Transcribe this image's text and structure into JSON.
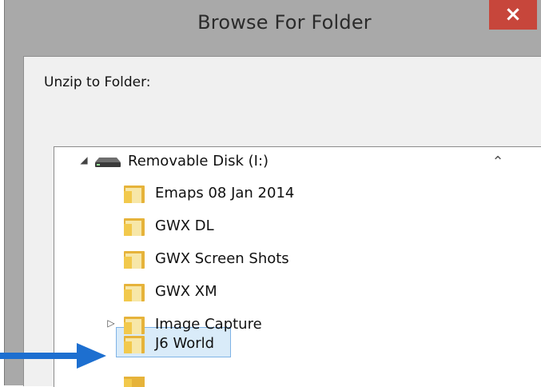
{
  "window": {
    "title": "Browse For Folder",
    "close_label": "×"
  },
  "dialog": {
    "prompt": "Unzip to Folder:"
  },
  "tree": {
    "root": {
      "label": "Removable Disk (I:)",
      "expanded": true,
      "icon": "removable-drive-icon"
    },
    "items": [
      {
        "label": "Emaps 08 Jan 2014",
        "icon": "folder-icon",
        "has_children": false
      },
      {
        "label": "GWX DL",
        "icon": "folder-icon",
        "has_children": false
      },
      {
        "label": "GWX Screen Shots",
        "icon": "folder-icon",
        "has_children": false
      },
      {
        "label": "GWX XM",
        "icon": "folder-icon",
        "has_children": false
      },
      {
        "label": "Image Capture",
        "icon": "folder-icon",
        "has_children": true
      },
      {
        "label": "J6 World",
        "icon": "folder-icon",
        "has_children": false,
        "selected": true
      }
    ]
  },
  "annotation": {
    "arrow_color": "#1d6fd0"
  },
  "colors": {
    "frame": "#a9a9a9",
    "close_button": "#c7463b",
    "selection_fill": "#d9ebf9",
    "selection_border": "#7fb3e6",
    "folder": "#f2c94c"
  }
}
